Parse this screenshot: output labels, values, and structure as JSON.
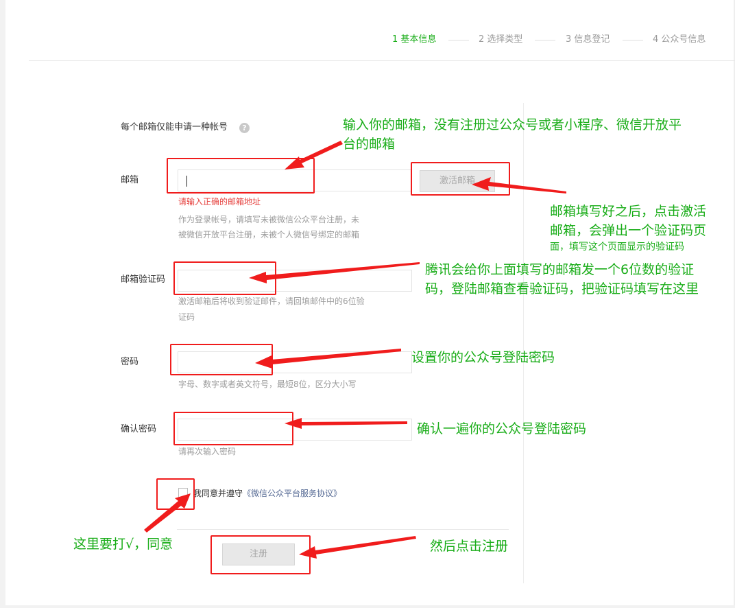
{
  "steps": [
    {
      "label": "1 基本信息",
      "active": true
    },
    {
      "label": "2 选择类型",
      "active": false
    },
    {
      "label": "3 信息登记",
      "active": false
    },
    {
      "label": "4 公众号信息",
      "active": false
    }
  ],
  "form": {
    "notice": "每个邮箱仅能申请一种帐号",
    "help_icon": "?",
    "email": {
      "label": "邮箱",
      "value": "",
      "activate_button": "激活邮箱",
      "error": "请输入正确的邮箱地址",
      "tip_line1": "作为登录帐号，请填写未被微信公众平台注册，未",
      "tip_line2": "被微信开放平台注册，未被个人微信号绑定的邮箱"
    },
    "code": {
      "label": "邮箱验证码",
      "value": "",
      "tip_line1": "激活邮箱后将收到验证邮件，请回填邮件中的6位验",
      "tip_line2": "证码"
    },
    "password": {
      "label": "密码",
      "value": "",
      "tip": "字母、数字或者英文符号，最短8位，区分大小写"
    },
    "confirm": {
      "label": "确认密码",
      "value": "",
      "tip": "请再次输入密码"
    },
    "agree": {
      "checked": false,
      "text": "我同意并遵守",
      "link": "《微信公众平台服务协议》"
    },
    "register_button": "注册"
  },
  "annotations": {
    "email_line1": "输入你的邮箱，没有注册过公众号或者小程序、微信开放平",
    "email_line2": "台的邮箱",
    "activate_line1": "邮箱填写好之后，点击激活",
    "activate_line2": "邮箱，会弹出一个验证码页",
    "activate_line3": "面，填写这个页面显示的验证码",
    "code_line1": "腾讯会给你上面填写的邮箱发一个6位数的验证",
    "code_line2": "码，登陆邮箱查看验证码，把验证码填写在这里",
    "password": "设置你的公众号登陆密码",
    "confirm": "确认一遍你的公众号登陆密码",
    "agree": "这里要打√，同意",
    "register": "然后点击注册"
  },
  "colors": {
    "accent_green": "#1aad19",
    "annotation_red": "#f01c1c",
    "error_red": "#e64340",
    "link_blue": "#576b95"
  }
}
